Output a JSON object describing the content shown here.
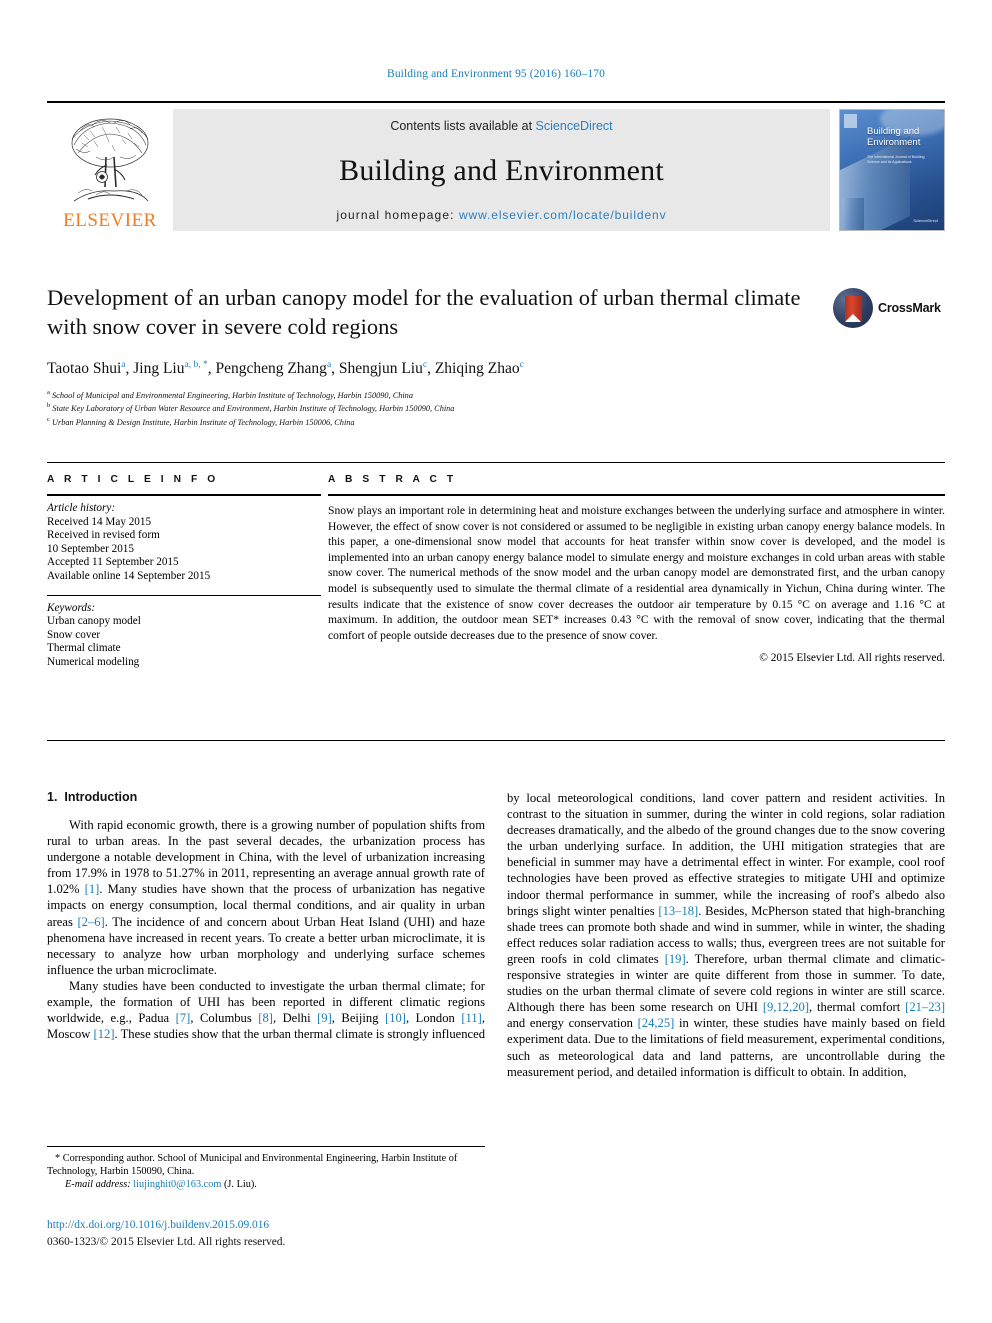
{
  "running_head": "Building and Environment 95 (2016) 160–170",
  "masthead": {
    "publisher_name": "ELSEVIER",
    "contents_prefix": "Contents lists available at ",
    "sciencedirect": "ScienceDirect",
    "journal_title": "Building and Environment",
    "homepage_prefix": "journal homepage: ",
    "homepage_url": "www.elsevier.com/locate/buildenv",
    "cover_title_line1": "Building and",
    "cover_title_line2": "Environment",
    "cover_sub": "The International Journal of Building Science and its Applications",
    "cover_tag": "ScienceDirect"
  },
  "article": {
    "title": "Development of an urban canopy model for the evaluation of urban thermal climate with snow cover in severe cold regions",
    "crossmark_label": "CrossMark",
    "authors": [
      {
        "name": "Taotao Shui",
        "marks": "a"
      },
      {
        "name": "Jing Liu",
        "marks": "a, b, *"
      },
      {
        "name": "Pengcheng Zhang",
        "marks": "a"
      },
      {
        "name": "Shengjun Liu",
        "marks": "c"
      },
      {
        "name": "Zhiqing Zhao",
        "marks": "c"
      }
    ],
    "affiliations": [
      {
        "mark": "a",
        "text": "School of Municipal and Environmental Engineering, Harbin Institute of Technology, Harbin 150090, China"
      },
      {
        "mark": "b",
        "text": "State Key Laboratory of Urban Water Resource and Environment, Harbin Institute of Technology, Harbin 150090, China"
      },
      {
        "mark": "c",
        "text": "Urban Planning & Design Institute, Harbin Institute of Technology, Harbin 150006, China"
      }
    ]
  },
  "article_info": {
    "heading": "A R T I C L E   I N F O",
    "history_label": "Article history:",
    "history": [
      "Received 14 May 2015",
      "Received in revised form",
      "10 September 2015",
      "Accepted 11 September 2015",
      "Available online 14 September 2015"
    ],
    "keywords_label": "Keywords:",
    "keywords": [
      "Urban canopy model",
      "Snow cover",
      "Thermal climate",
      "Numerical modeling"
    ]
  },
  "abstract": {
    "heading": "A B S T R A C T",
    "text": "Snow plays an important role in determining heat and moisture exchanges between the underlying surface and atmosphere in winter. However, the effect of snow cover is not considered or assumed to be negligible in existing urban canopy energy balance models. In this paper, a one-dimensional snow model that accounts for heat transfer within snow cover is developed, and the model is implemented into an urban canopy energy balance model to simulate energy and moisture exchanges in cold urban areas with stable snow cover. The numerical methods of the snow model and the urban canopy model are demonstrated first, and the urban canopy model is subsequently used to simulate the thermal climate of a residential area dynamically in Yichun, China during winter. The results indicate that the existence of snow cover decreases the outdoor air temperature by 0.15 °C on average and 1.16 °C at maximum. In addition, the outdoor mean SET* increases 0.43 °C with the removal of snow cover, indicating that the thermal comfort of people outside decreases due to the presence of snow cover.",
    "copyright": "© 2015 Elsevier Ltd. All rights reserved."
  },
  "introduction": {
    "section_number": "1.",
    "section_title": "Introduction",
    "left_paragraph_1": "With rapid economic growth, there is a growing number of population shifts from rural to urban areas. In the past several decades, the urbanization process has undergone a notable development in China, with the level of urbanization increasing from 17.9% in 1978 to 51.27% in 2011, representing an average annual growth rate of 1.02% [1]. Many studies have shown that the process of urbanization has negative impacts on energy consumption, local thermal conditions, and air quality in urban areas [2–6]. The incidence of and concern about Urban Heat Island (UHI) and haze phenomena have increased in recent years. To create a better urban microclimate, it is necessary to analyze how urban morphology and underlying surface schemes influence the urban microclimate.",
    "left_paragraph_2": "Many studies have been conducted to investigate the urban thermal climate; for example, the formation of UHI has been reported in different climatic regions worldwide, e.g., Padua [7], Columbus [8], Delhi [9], Beijing [10], London [11], Moscow [12]. These studies show that the urban thermal climate is strongly influenced",
    "right_paragraph_continued": "by local meteorological conditions, land cover pattern and resident activities. In contrast to the situation in summer, during the winter in cold regions, solar radiation decreases dramatically, and the albedo of the ground changes due to the snow covering the urban underlying surface. In addition, the UHI mitigation strategies that are beneficial in summer may have a detrimental effect in winter. For example, cool roof technologies have been proved as effective strategies to mitigate UHI and optimize indoor thermal performance in summer, while the increasing of roof's albedo also brings slight winter penalties [13–18]. Besides, McPherson stated that high-branching shade trees can promote both shade and wind in summer, while in winter, the shading effect reduces solar radiation access to walls; thus, evergreen trees are not suitable for green roofs in cold climates [19]. Therefore, urban thermal climate and climatic-responsive strategies in winter are quite different from those in summer. To date, studies on the urban thermal climate of severe cold regions in winter are still scarce. Although there has been some research on UHI [9,12,20], thermal comfort [21–23] and energy conservation [24,25] in winter, these studies have mainly based on field experiment data. Due to the limitations of field measurement, experimental conditions, such as meteorological data and land patterns, are uncontrollable during the measurement period, and detailed information is difficult to obtain. In addition,"
  },
  "footnotes": {
    "corresponding": "* Corresponding author. School of Municipal and Environmental Engineering, Harbin Institute of Technology, Harbin 150090, China.",
    "email_label": "E-mail address:",
    "email": "liujinghit0@163.com",
    "email_owner": "(J. Liu).",
    "doi_url": "http://dx.doi.org/10.1016/j.buildenv.2015.09.016",
    "issn_line": "0360-1323/© 2015 Elsevier Ltd. All rights reserved."
  },
  "colors": {
    "link_blue": "#1a7db6",
    "elsevier_orange": "#f07c22",
    "banner_gray": "#e8e8e8"
  }
}
